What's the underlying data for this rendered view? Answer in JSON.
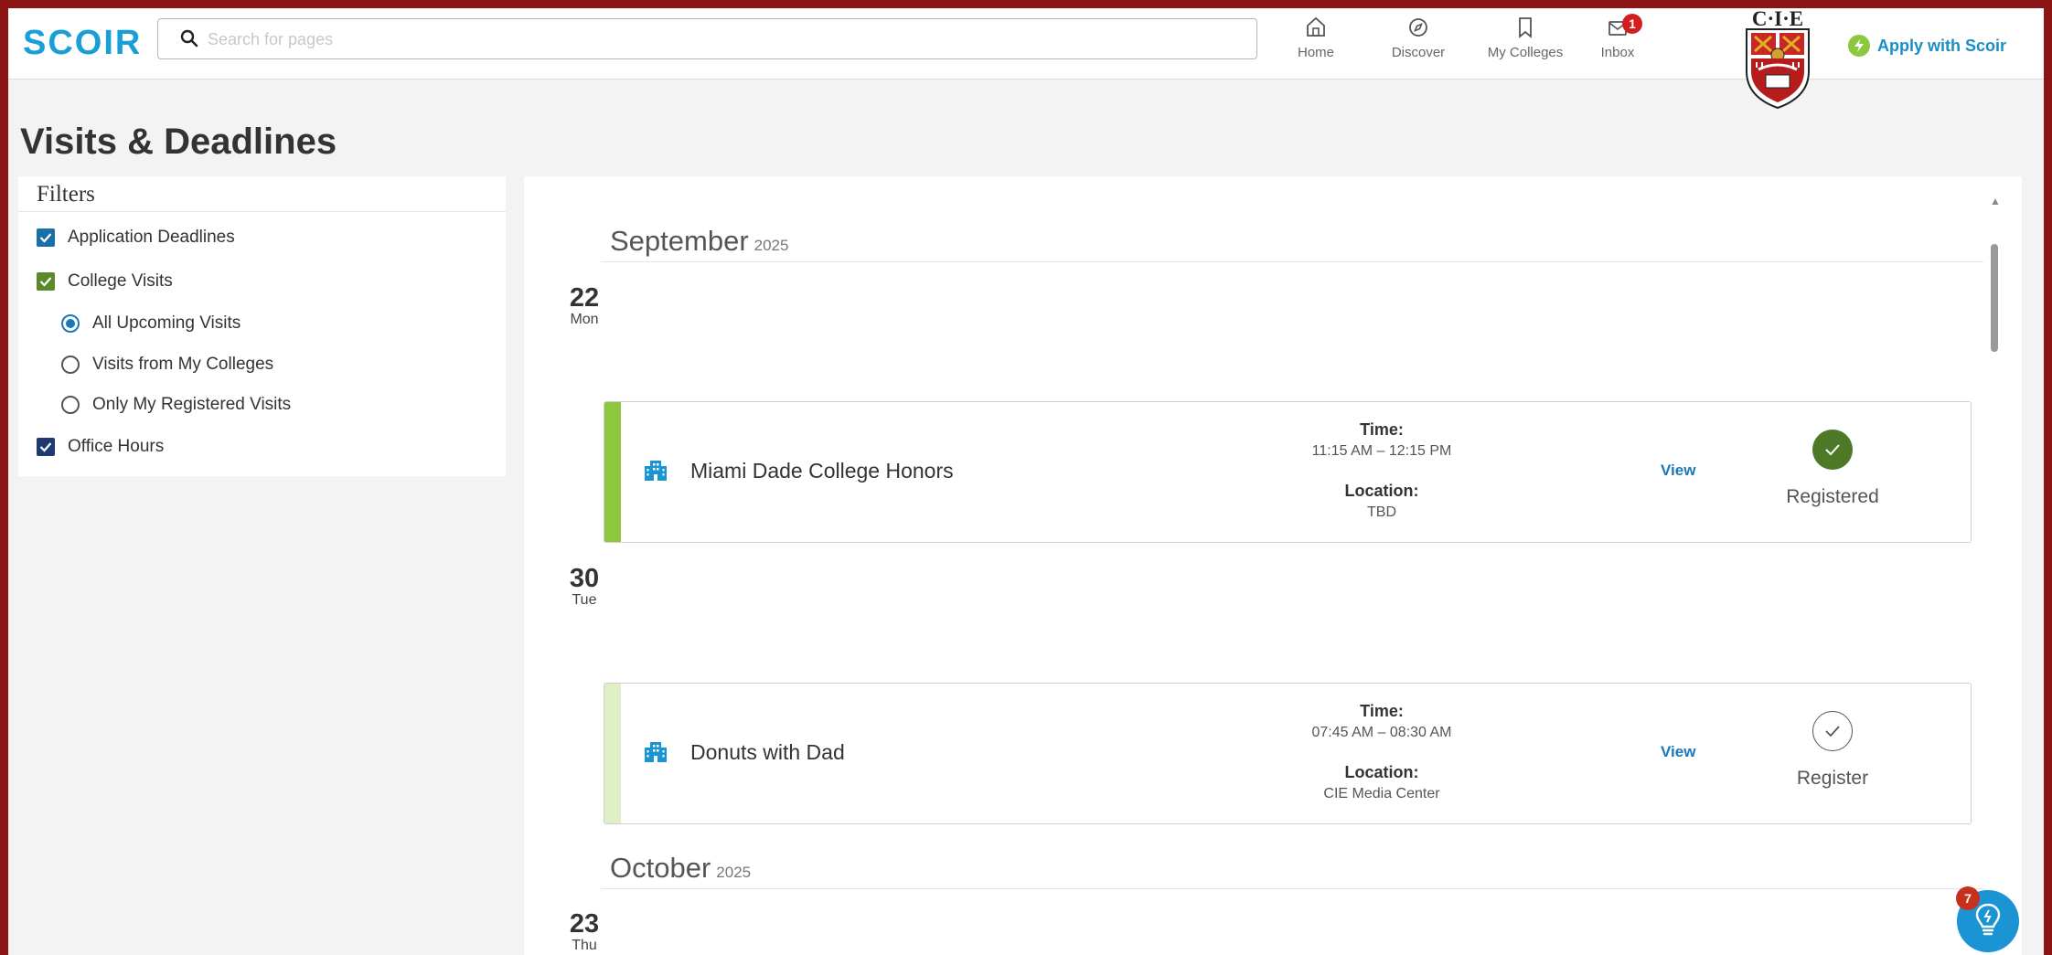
{
  "header": {
    "logo": "SCOIR",
    "search_placeholder": "Search for pages",
    "nav": [
      {
        "label": "Home",
        "icon": "home-icon"
      },
      {
        "label": "Discover",
        "icon": "compass-icon"
      },
      {
        "label": "My Colleges",
        "icon": "bookmark-icon"
      },
      {
        "label": "Inbox",
        "icon": "inbox-icon",
        "badge": "1"
      }
    ],
    "crest_text": "C·I·E",
    "apply_label": "Apply with Scoir"
  },
  "page": {
    "title": "Visits & Deadlines"
  },
  "filters": {
    "title": "Filters",
    "items": [
      {
        "label": "Application Deadlines",
        "type": "checkbox",
        "checked": true,
        "color": "#1a6fa8"
      },
      {
        "label": "College Visits",
        "type": "checkbox",
        "checked": true,
        "color": "#5a8a2a"
      },
      {
        "label": "All Upcoming Visits",
        "type": "radio",
        "checked": true
      },
      {
        "label": "Visits from My Colleges",
        "type": "radio",
        "checked": false
      },
      {
        "label": "Only My Registered Visits",
        "type": "radio",
        "checked": false
      },
      {
        "label": "Office Hours",
        "type": "checkbox",
        "checked": true,
        "color": "#1e3a6e"
      }
    ]
  },
  "calendar": {
    "months": [
      {
        "name": "September",
        "year": "2025"
      },
      {
        "name": "October",
        "year": "2025"
      }
    ],
    "days": [
      {
        "num": "22",
        "dow": "Mon"
      },
      {
        "num": "30",
        "dow": "Tue"
      },
      {
        "num": "23",
        "dow": "Thu"
      }
    ],
    "events": [
      {
        "title": "Miami Dade College Honors",
        "time_label": "Time:",
        "time": "11:15 AM – 12:15 PM",
        "location_label": "Location:",
        "location": "TBD",
        "view_label": "View",
        "status": "Registered",
        "bar_color": "#8dc63f"
      },
      {
        "title": "Donuts with Dad",
        "time_label": "Time:",
        "time": "07:45 AM – 08:30 AM",
        "location_label": "Location:",
        "location": "CIE Media Center",
        "view_label": "View",
        "status": "Register",
        "bar_color": "#dff0c4"
      }
    ]
  },
  "help": {
    "badge": "7"
  }
}
